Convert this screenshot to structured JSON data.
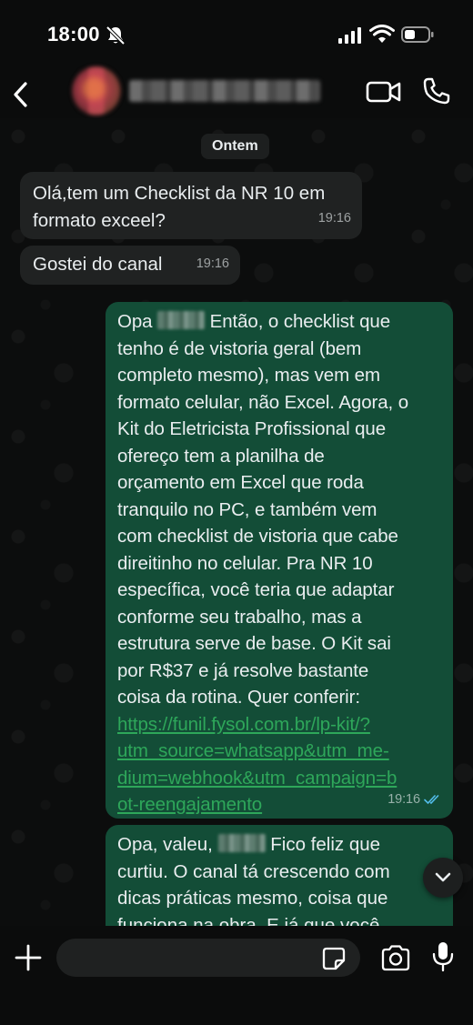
{
  "status_bar": {
    "time": "18:00"
  },
  "header": {
    "back_icon": "chevron-left-icon",
    "video_icon": "video-camera-icon",
    "call_icon": "phone-icon"
  },
  "chat": {
    "date_separator": "Ontem",
    "messages": [
      {
        "direction": "incoming",
        "text": "Olá,tem um Checklist da NR 10 em\nformato exceel?",
        "time": "19:16"
      },
      {
        "direction": "incoming",
        "text": "Gostei do canal",
        "time": "19:16"
      },
      {
        "direction": "outgoing",
        "text_start": "Opa",
        "text": " Então, o checklist que\ntenho é de vistoria geral (bem\ncompleto mesmo), mas vem em\nformato celular, não Excel. Agora, o\nKit do Eletricista Profissional que\nofereço tem a planilha de\norçamento em Excel que roda\ntranquilo no PC, e também vem\ncom checklist de vistoria que cabe\ndireitinho no celular. Pra NR 10\nespecífica, você teria que adaptar\nconforme seu trabalho, mas a\nestrutura serve de base. O Kit sai\npor R$37 e já resolve bastante\ncoisa da rotina. Quer conferir:",
        "link": "https://funil.fysol.com.br/lp-kit/?\nutm_source=whatsapp&utm_me-\ndium=webhook&utm_campaign=b\not-reengajamento",
        "time": "19:16",
        "status_icon": "double-check-icon"
      },
      {
        "direction": "outgoing",
        "text_start": "Opa, valeu,",
        "text": " Fico feliz que\ncurtiu. O canal tá crescendo com\ndicas práticas mesmo, coisa que\nfunciona na obra. E já que você"
      }
    ]
  },
  "input_bar": {
    "placeholder": ""
  },
  "colors": {
    "incoming_bubble": "#202222",
    "outgoing_bubble": "#134d37",
    "link": "#2ea75a",
    "read_ticks": "#53bdeb"
  }
}
